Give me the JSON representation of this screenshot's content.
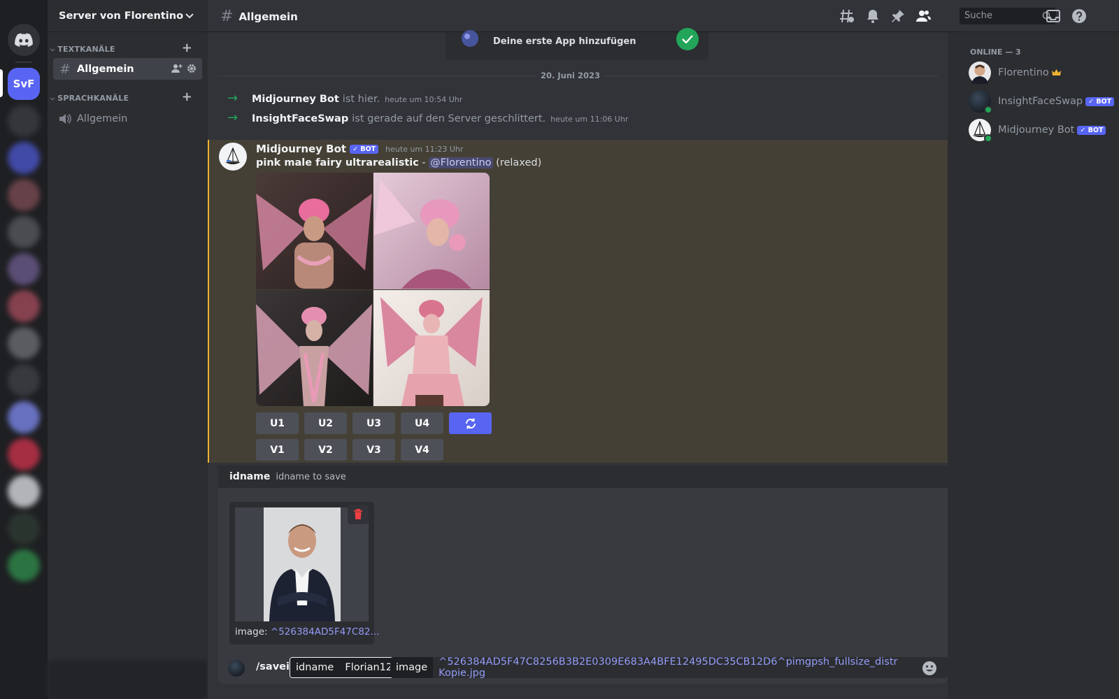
{
  "server": {
    "short": "SvF",
    "name": "Server von Florentino"
  },
  "sidebar": {
    "text_category": "TEXTKANÄLE",
    "voice_category": "SPRACHKANÄLE",
    "text_channels": [
      {
        "name": "Allgemein"
      }
    ],
    "voice_channels": [
      {
        "name": "Allgemein"
      }
    ]
  },
  "header": {
    "channel": "Allgemein",
    "search_placeholder": "Suche"
  },
  "chat": {
    "welcome_card": {
      "text": "Deine erste App hinzufügen"
    },
    "date_divider": "20. Juni 2023",
    "system_messages": [
      {
        "who": "Midjourney Bot",
        "text": "ist hier.",
        "time": "heute um 10:54 Uhr"
      },
      {
        "who": "InsightFaceSwap",
        "text": "ist gerade auf den Server geschlittert.",
        "time": "heute um 11:06 Uhr"
      }
    ],
    "message": {
      "author": "Midjourney Bot",
      "badge": "✓ BOT",
      "time": "heute um 11:23 Uhr",
      "prompt": "pink male fairy ultrarealistic",
      "separator": " - ",
      "mention": "@Florentino",
      "mode": " (relaxed)",
      "upscale_buttons": [
        "U1",
        "U2",
        "U3",
        "U4"
      ],
      "variation_buttons": [
        "V1",
        "V2",
        "V3",
        "V4"
      ]
    }
  },
  "command": {
    "option_name": "idname",
    "option_description": "idname to save",
    "attachment_caption_label": "image: ",
    "attachment_caption_value": "^526384AD5F47C82...",
    "name": "/saveid",
    "idname_key": "idname",
    "idname_value": "Florian12",
    "image_key": "image",
    "image_value": "^526384AD5F47C8256B3B2E0309E683A4BFE12495DC35CB12D6^pimgpsh_fullsize_distr Kopie.jpg"
  },
  "members": {
    "heading": "ONLINE — 3",
    "list": [
      {
        "name": "Florentino",
        "badge": ""
      },
      {
        "name": "InsightFaceSwap",
        "badge": "✓ BOT"
      },
      {
        "name": "Midjourney Bot",
        "badge": "✓ BOT"
      }
    ]
  },
  "colors": {
    "accent": "#5865f2",
    "online": "#23a559",
    "mention_bg": "#444035",
    "mention_bar": "#f0b232",
    "crown": "#f0b232"
  }
}
